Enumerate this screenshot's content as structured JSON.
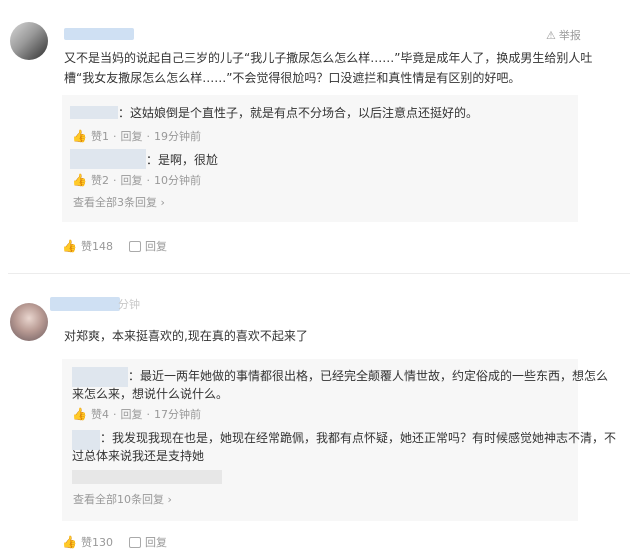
{
  "comment1": {
    "report_label": "举报",
    "text_line1": "又不是当妈的说起自己三岁的儿子“我儿子撒尿怎么怎么样……”毕竟是成年人了，换成男生给别人吐",
    "text_line2": "槽“我女友撒尿怎么怎么样……”不会觉得很尬吗？口没遮拦和真性情是有区别的好吧。",
    "replies": [
      {
        "text": "：这姑娘倒是个直性子，就是有点不分场合，以后注意点还挺好的。",
        "likes": "赞1",
        "reply": "回复",
        "time": "19分钟前",
        "sep": "·"
      },
      {
        "text": "：是啊，很尬",
        "likes": "赞2",
        "reply": "回复",
        "time": "10分钟前",
        "sep": "·"
      }
    ],
    "more_replies": "查看全部3条回复",
    "footer_likes": "赞148",
    "footer_reply": "回复"
  },
  "comment2": {
    "time_blur": "分钟",
    "text": "对郑爽，本来挺喜欢的,现在真的喜欢不起来了",
    "replies": [
      {
        "text_line1": "：最近一两年她做的事情都很出格，已经完全颠覆人情世故，约定俗成的一些东西，想怎么",
        "text_line2": "来怎么来，想说什么说什么。",
        "likes": "赞4",
        "reply": "回复",
        "time": "17分钟前",
        "sep": "·"
      },
      {
        "text_line1": "：我发现我现在也是，她现在经常跪佩，我都有点怀疑，她还正常吗？有时候感觉她神志不清，不",
        "text_line2": "过总体来说我还是支持她"
      }
    ],
    "more_replies": "查看全部10条回复",
    "footer_likes": "赞130",
    "footer_reply": "回复"
  },
  "colors": {
    "accent": "#3b82d6",
    "muted": "#999999",
    "reply_bg": "#f7f7f7"
  }
}
